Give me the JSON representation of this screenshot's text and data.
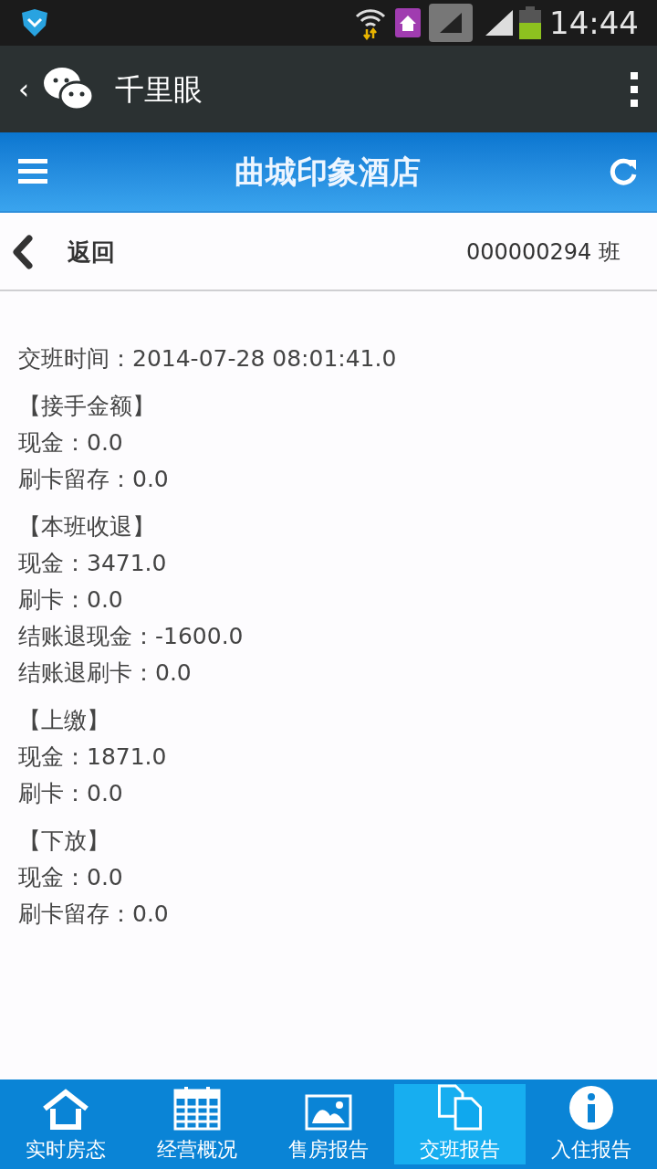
{
  "status_bar": {
    "time": "14:44"
  },
  "app_bar": {
    "back": "‹",
    "title": "千里眼"
  },
  "header": {
    "title": "曲城印象酒店"
  },
  "sub_bar": {
    "back_label": "返回",
    "shift": "000000294 班"
  },
  "report": {
    "time_line": "交班时间：2014-07-28 08:01:41.0",
    "sections": [
      {
        "heading": "【接手金额】",
        "lines": [
          "现金：0.0",
          "刷卡留存：0.0"
        ]
      },
      {
        "heading": "【本班收退】",
        "lines": [
          "现金：3471.0",
          "刷卡：0.0",
          "结账退现金：-1600.0",
          "结账退刷卡：0.0"
        ]
      },
      {
        "heading": "【上缴】",
        "lines": [
          "现金：1871.0",
          "刷卡：0.0"
        ]
      },
      {
        "heading": "【下放】",
        "lines": [
          "现金：0.0",
          "刷卡留存：0.0"
        ]
      }
    ]
  },
  "bottom_nav": [
    {
      "kind": "home",
      "label": "实时房态",
      "selected": false
    },
    {
      "kind": "calendar",
      "label": "经营概况",
      "selected": false
    },
    {
      "kind": "image",
      "label": "售房报告",
      "selected": false
    },
    {
      "kind": "documents",
      "label": "交班报告",
      "selected": true
    },
    {
      "kind": "info",
      "label": "入住报告",
      "selected": false
    }
  ]
}
